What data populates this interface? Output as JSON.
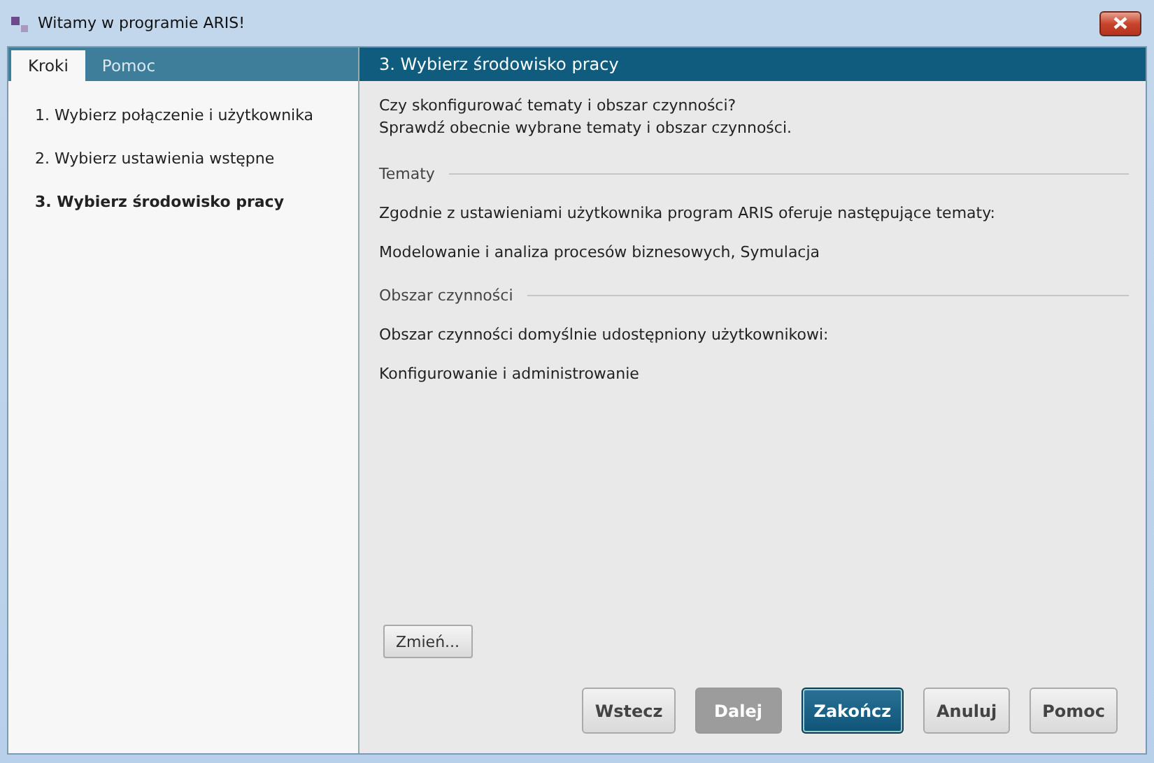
{
  "window": {
    "title": "Witamy w programie ARIS!"
  },
  "tabs": [
    {
      "label": "Kroki",
      "selected": true
    },
    {
      "label": "Pomoc",
      "selected": false
    }
  ],
  "steps": [
    {
      "label": "1. Wybierz połączenie i użytkownika",
      "selected": false
    },
    {
      "label": "2. Wybierz ustawienia wstępne",
      "selected": false
    },
    {
      "label": "3. Wybierz środowisko pracy",
      "selected": true
    }
  ],
  "page": {
    "title": "3. Wybierz środowisko pracy",
    "intro": [
      "Czy skonfigurować tematy i obszar czynności?",
      "Sprawdź obecnie wybrane tematy i obszar czynności."
    ],
    "sections": [
      {
        "heading": "Tematy",
        "description": "Zgodnie z ustawieniami użytkownika program ARIS oferuje następujące tematy:",
        "value": "Modelowanie i analiza procesów biznesowych, Symulacja"
      },
      {
        "heading": "Obszar czynności",
        "description": "Obszar czynności domyślnie udostępniony użytkownikowi:",
        "value": "Konfigurowanie i administrowanie"
      }
    ],
    "change_button": "Zmień..."
  },
  "buttons": [
    {
      "label": "Wstecz",
      "primary": false,
      "disabled": false
    },
    {
      "label": "Dalej",
      "primary": false,
      "disabled": true
    },
    {
      "label": "Zakończ",
      "primary": true,
      "disabled": false
    },
    {
      "label": "Anuluj",
      "primary": false,
      "disabled": false
    },
    {
      "label": "Pomoc",
      "primary": false,
      "disabled": false
    }
  ]
}
